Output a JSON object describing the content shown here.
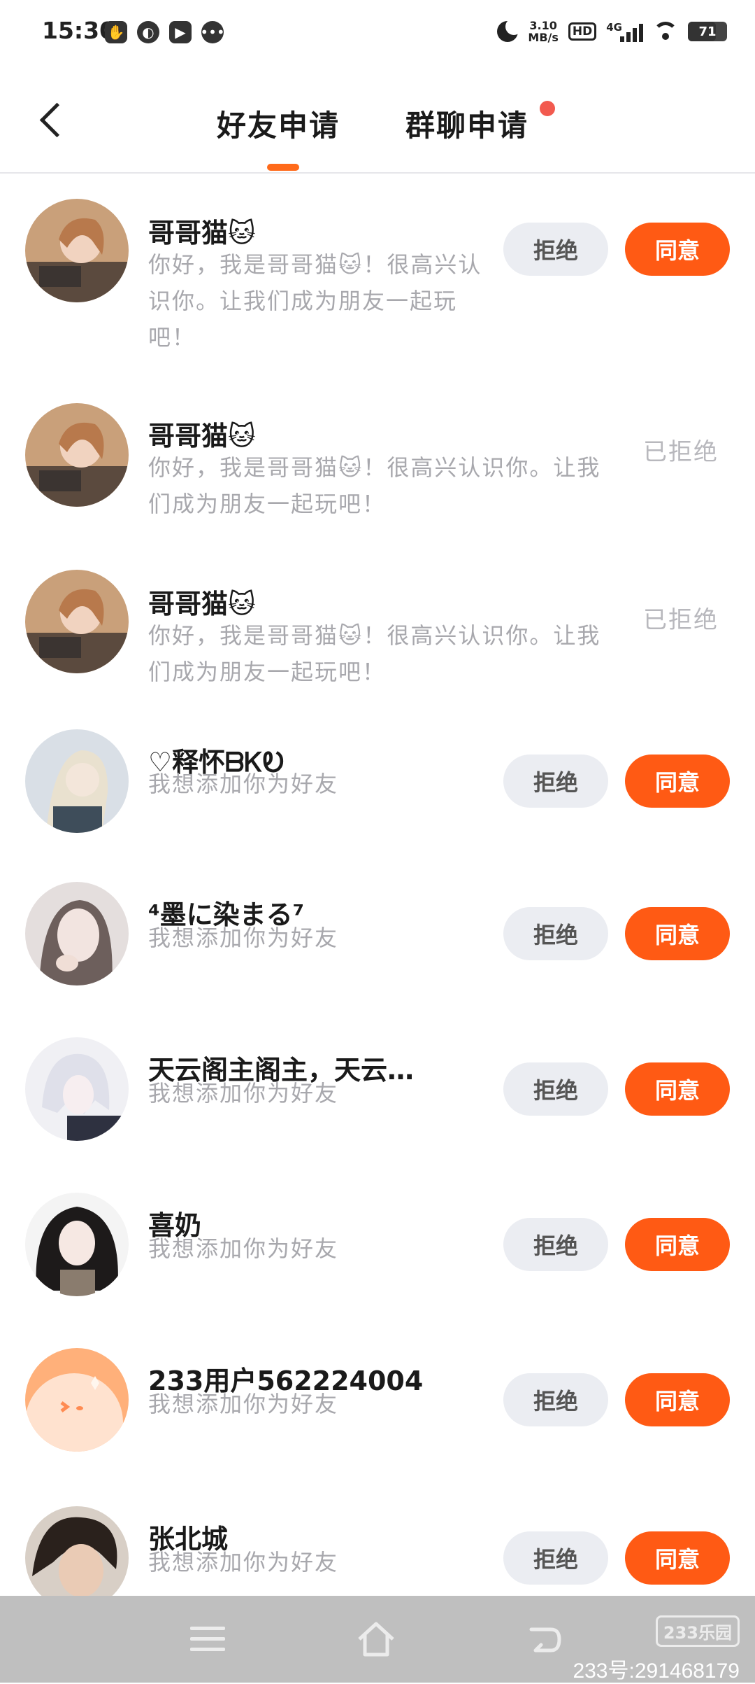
{
  "status_bar": {
    "time": "15:30",
    "net_speed_value": "3.10",
    "net_speed_unit": "MB/s",
    "hd_label": "HD",
    "signal_label": "4G",
    "battery": "71",
    "battery_level": 0.71
  },
  "header": {
    "tab_friend": "好友申请",
    "tab_group": "群聊申请"
  },
  "actions": {
    "reject": "拒绝",
    "accept": "同意"
  },
  "requests": [
    {
      "name": "哥哥猫🐱",
      "message": "你好，我是哥哥猫🐱！很高兴认识你。让我们成为朋友一起玩吧！",
      "status": "pending"
    },
    {
      "name": "哥哥猫🐱",
      "message": "你好，我是哥哥猫🐱！很高兴认识你。让我们成为朋友一起玩吧！",
      "status": "已拒绝"
    },
    {
      "name": "哥哥猫🐱",
      "message": "你好，我是哥哥猫🐱！很高兴认识你。让我们成为朋友一起玩吧！",
      "status": "已拒绝"
    },
    {
      "name": "♡释怀ᗷᏦᎧ",
      "message": "我想添加你为好友",
      "status": "pending"
    },
    {
      "name": "⁴墨に染まる⁷",
      "message": "我想添加你为好友",
      "status": "pending"
    },
    {
      "name": "天云阁主阁主，天云…",
      "message": "我想添加你为好友",
      "status": "pending"
    },
    {
      "name": "喜奶",
      "message": "我想添加你为好友",
      "status": "pending"
    },
    {
      "name": "233用户562224004",
      "message": "我想添加你为好友",
      "status": "pending"
    },
    {
      "name": "张北城",
      "message": "我想添加你为好友",
      "status": "pending"
    }
  ],
  "watermark": {
    "logo": "233乐园",
    "id": "233号:291468179"
  },
  "colors": {
    "accent": "#ff5a14",
    "tab_underline": "#ff6a1a",
    "reject_bg": "#ebedf2",
    "message_text": "#a8a8ad",
    "notice_dot": "#f25a4f"
  }
}
